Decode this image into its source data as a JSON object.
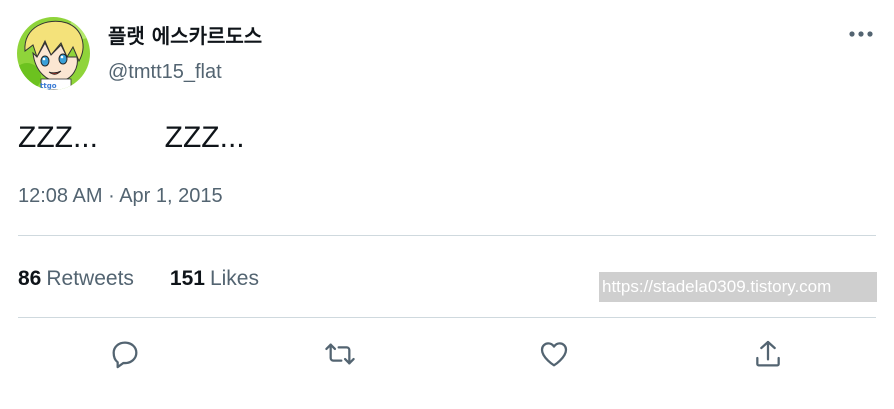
{
  "author": {
    "display_name": "플랫 에스카르도스",
    "handle": "@tmtt15_flat",
    "avatar_icon": "anime-avatar",
    "avatar_text": "ttgo"
  },
  "menu_icon": "more-options-icon",
  "tweet": {
    "text": "ZZZ...        ZZZ...",
    "time": "12:08 AM",
    "separator": " · ",
    "date": "Apr 1, 2015"
  },
  "stats": {
    "retweets_count": "86",
    "retweets_label": "Retweets",
    "likes_count": "151",
    "likes_label": "Likes"
  },
  "watermark": "https://stadela0309.tistory.com",
  "actions": [
    "reply-icon",
    "retweet-icon",
    "like-icon",
    "share-icon"
  ],
  "colors": {
    "text": "#0f1419",
    "secondary": "#536471",
    "divider": "#cfd9de",
    "icon": "#536471"
  }
}
